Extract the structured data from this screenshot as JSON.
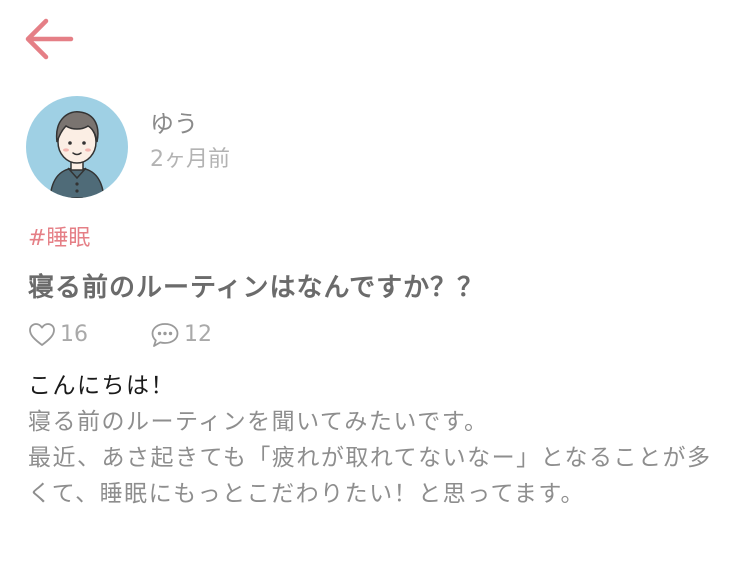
{
  "header": {
    "back_icon": "arrow-left-icon",
    "accent_color": "#e57f86"
  },
  "author": {
    "name": "ゆう",
    "posted_ago": "2ヶ月前",
    "avatar_icon": "user-avatar-illustration"
  },
  "post": {
    "tag": "#睡眠",
    "title": "寝る前のルーティンはなんですか？？",
    "likes": "16",
    "comments": "12",
    "body": {
      "greeting": "こんにちは！",
      "line1": "寝る前のルーティンを聞いてみたいです。",
      "line2": "最近、あさ起きても「疲れが取れてないなー」となることが多くて、睡眠にもっとこだわりたい！と思ってます。"
    }
  }
}
